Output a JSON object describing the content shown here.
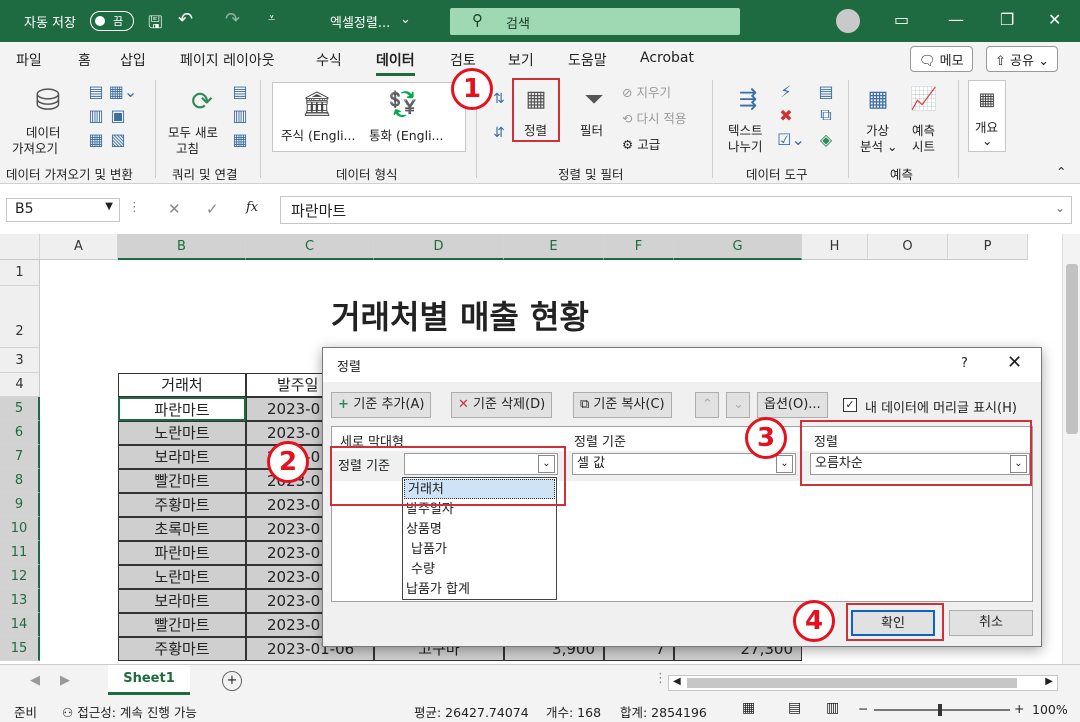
{
  "titlebar": {
    "autosave": "자동 저장",
    "toggle": "끔",
    "filename": "엑셀정렬...",
    "search": "검색"
  },
  "menus": [
    "파일",
    "홈",
    "삽입",
    "페이지 레이아웃",
    "수식",
    "데이터",
    "검토",
    "보기",
    "도움말",
    "Acrobat"
  ],
  "menu_memo": "메모",
  "menu_share": "공유",
  "ribbon": {
    "get_data": [
      "데이터",
      "가져오기"
    ],
    "refresh": [
      "모두 새로",
      "고침"
    ],
    "stock": "주식 (Engli...",
    "currency": "통화 (Engli...",
    "sort": "정렬",
    "filter": "필터",
    "clear": "지우기",
    "reapply": "다시 적용",
    "advanced": "고급",
    "text_to_col": [
      "텍스트",
      "나누기"
    ],
    "whatif": [
      "가상",
      "분석"
    ],
    "forecast": [
      "예측",
      "시트"
    ],
    "outline": "개요",
    "groups": [
      "데이터 가져오기 및 변환",
      "쿼리 및 연결",
      "데이터 형식",
      "정렬 및 필터",
      "데이터 도구",
      "예측"
    ]
  },
  "formula": {
    "namebox": "B5",
    "fx": "fx",
    "value": "파란마트"
  },
  "columns": [
    "A",
    "B",
    "C",
    "D",
    "E",
    "F",
    "G",
    "H",
    "O",
    "P"
  ],
  "rows": [
    "1",
    "2",
    "3",
    "4",
    "5",
    "6",
    "7",
    "8",
    "9",
    "10",
    "11",
    "12",
    "13",
    "14",
    "15"
  ],
  "sheet": {
    "title": "거래처별 매출 현황",
    "hdr_b": "거래처",
    "hdr_c": "발주일",
    "stores": [
      "파란마트",
      "노란마트",
      "보라마트",
      "빨간마트",
      "주황마트",
      "초록마트",
      "파란마트",
      "노란마트",
      "보라마트",
      "빨간마트",
      "주황마트"
    ],
    "dates": [
      "2023-0",
      "2023-0",
      "2023-0",
      "2023-0",
      "2023-0",
      "2023-0",
      "2023-0",
      "2023-0",
      "2023-0",
      "2023-0",
      "2023-01-06"
    ],
    "row15": {
      "d": "고구마",
      "e": "3,900",
      "f": "7",
      "g": "27,300"
    }
  },
  "dialog": {
    "title": "정렬",
    "help": "?",
    "add": "기준 추가(A)",
    "delete": "기준 삭제(D)",
    "copy": "기준 복사(C)",
    "options": "옵션(O)...",
    "header_check": "내 데이터에 머리글 표시(H)",
    "col_hdr": "세로 막대형",
    "sorton_hdr": "정렬 기준",
    "order_hdr": "정렬",
    "sortby": "정렬 기준",
    "sorton_val": "셀 값",
    "order_val": "오름차순",
    "list": [
      "거래처",
      "발주일자",
      "상품명",
      "납품가",
      "수량",
      "납품가 합계"
    ],
    "ok": "확인",
    "cancel": "취소"
  },
  "badges": [
    "1",
    "2",
    "3",
    "4"
  ],
  "tabs": {
    "sheet1": "Sheet1",
    "add": "+"
  },
  "status": {
    "ready": "준비",
    "access": "접근성: 계속 진행 가능",
    "avg": "평균: 26427.74074",
    "count": "개수: 168",
    "sum": "합계: 2854196",
    "zoom": "100%"
  }
}
